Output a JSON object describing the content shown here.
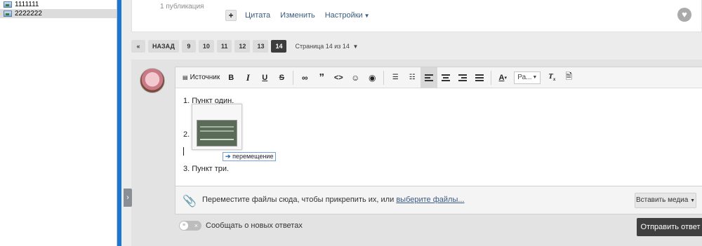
{
  "left_panel": {
    "files": [
      {
        "name": "1111111",
        "selected": false
      },
      {
        "name": "2222222",
        "selected": true
      }
    ]
  },
  "post": {
    "publications": "1 публикация",
    "actions": {
      "quote": "Цитата",
      "edit": "Изменить",
      "settings": "Настройки"
    }
  },
  "pagination": {
    "first": "«",
    "back": "НАЗАД",
    "pages": [
      "9",
      "10",
      "11",
      "12",
      "13",
      "14"
    ],
    "current": "14",
    "info": "Страница 14 из 14"
  },
  "editor": {
    "toolbar": {
      "source": "Источник",
      "bold": "B",
      "italic": "I",
      "underline": "U",
      "strike": "S",
      "font_select": "Ра..."
    },
    "content": {
      "item1": "1. Пункт один.",
      "item2": "2. Пункт два.",
      "item3": "3. Пункт три."
    },
    "drag_tooltip": "перемещение"
  },
  "attach": {
    "text": "Переместите файлы сюда, чтобы прикрепить их, или",
    "link": "выберите файлы...",
    "media_button": "Вставить медиа"
  },
  "footer": {
    "notify_label": "Сообщать о новых ответах",
    "submit": "Отправить ответ"
  },
  "colors": {
    "accent_blue": "#1976d2",
    "link": "#3a5a82",
    "submit_bg": "#3f3f3f"
  }
}
